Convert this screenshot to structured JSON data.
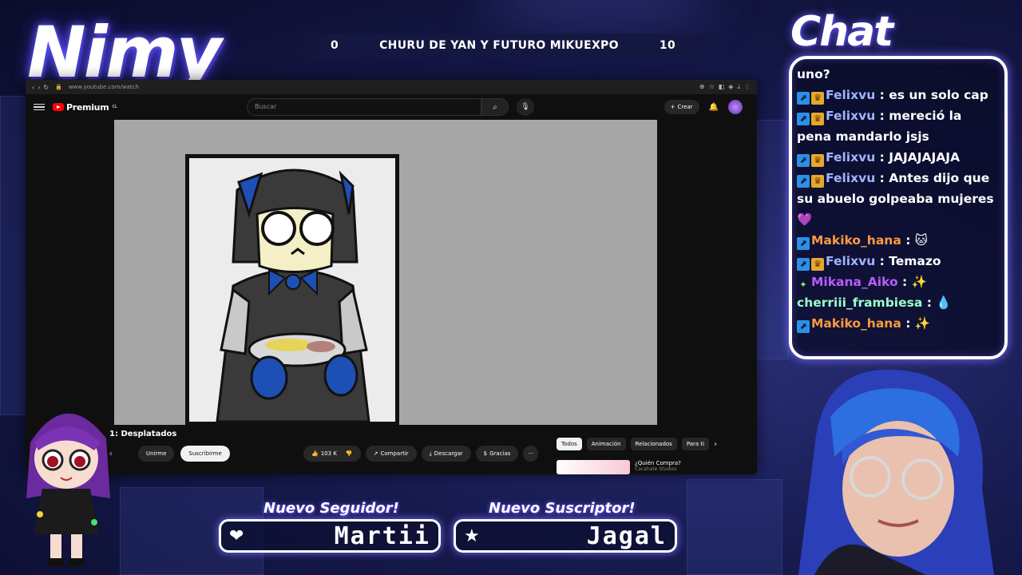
{
  "overlay": {
    "streamer_name": "Nimy",
    "score_left": "0",
    "score_title": "CHURU DE YAN Y FUTURO MIKUEXPO",
    "score_right": "10",
    "chat_title": "Chat"
  },
  "browser": {
    "url": "www.youtube.com/watch"
  },
  "youtube": {
    "logo_text": "Premium",
    "logo_region": "CL",
    "search_placeholder": "Buscar",
    "create_label": "Crear",
    "video_title": "1: Desplatados",
    "channel_meta": "s",
    "join_label": "Unirme",
    "subscribe_label": "Suscribirme",
    "likes": "103 K",
    "share_label": "Compartir",
    "download_label": "Descargar",
    "thanks_label": "Gracias",
    "more_label": "···",
    "chips": [
      "Todos",
      "Animación",
      "Relacionados",
      "Para ti"
    ],
    "rec_title": "¿Quién Compra?",
    "rec_channel": "Cacahate Studios"
  },
  "chat": {
    "messages": [
      {
        "badges": [],
        "user": "",
        "user_color": "#ffffff",
        "text": "uno?"
      },
      {
        "badges": [
          "prime",
          "crown"
        ],
        "user": "Felixvu",
        "user_color": "#9fb4ff",
        "text": "es un solo cap"
      },
      {
        "badges": [
          "prime",
          "crown"
        ],
        "user": "Felixvu",
        "user_color": "#9fb4ff",
        "text": "mereció la pena mandarlo jsjs"
      },
      {
        "badges": [
          "prime",
          "crown"
        ],
        "user": "Felixvu",
        "user_color": "#9fb4ff",
        "text": "JAJAJAJAJA"
      },
      {
        "badges": [
          "prime",
          "crown"
        ],
        "user": "Felixvu",
        "user_color": "#9fb4ff",
        "text": "Antes dijo que su abuelo golpeaba mujeres 💜"
      },
      {
        "badges": [
          "prime"
        ],
        "user": "Makiko_hana",
        "user_color": "#ff9a3c",
        "text": "🐱"
      },
      {
        "badges": [
          "prime",
          "crown"
        ],
        "user": "Felixvu",
        "user_color": "#9fb4ff",
        "text": "Temazo"
      },
      {
        "badges": [
          "star"
        ],
        "user": "Mikana_Aiko",
        "user_color": "#b85cff",
        "text": "✨"
      },
      {
        "badges": [],
        "user": "cherriii_frambiesa",
        "user_color": "#9affc9",
        "text": "💧"
      },
      {
        "badges": [
          "prime"
        ],
        "user": "Makiko_hana",
        "user_color": "#ff9a3c",
        "text": "✨"
      }
    ]
  },
  "alerts": {
    "follower_label": "Nuevo Seguidor!",
    "follower_name": "Martii",
    "subscriber_label": "Nuevo Suscriptor!",
    "subscriber_name": "Jagal"
  },
  "colors": {
    "accent_glow": "#6a5cff",
    "yt_red": "#ff0000"
  }
}
